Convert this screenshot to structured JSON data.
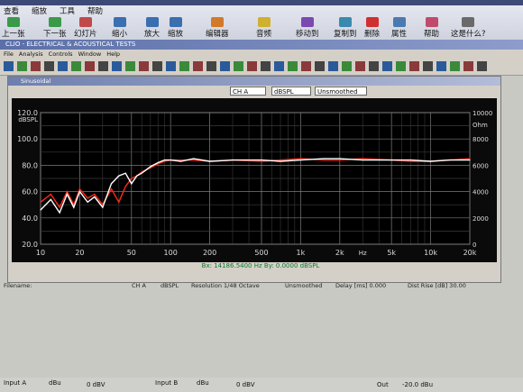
{
  "viewer": {
    "menu": [
      "查看",
      "缩放",
      "工具",
      "帮助"
    ],
    "tools": [
      {
        "label": "上一张",
        "icon": "prev-arrow-icon"
      },
      {
        "label": "下一张",
        "icon": "next-arrow-icon"
      },
      {
        "label": "幻灯片",
        "icon": "slideshow-icon"
      },
      {
        "label": "缩小",
        "icon": "zoom-out-icon"
      },
      {
        "label": "放大",
        "icon": "zoom-in-icon"
      },
      {
        "label": "缩放",
        "icon": "zoom-icon"
      },
      {
        "label": "编辑器",
        "icon": "editor-icon"
      },
      {
        "label": "音频",
        "icon": "audio-icon"
      },
      {
        "label": "移动到",
        "icon": "move-to-icon"
      },
      {
        "label": "复制到",
        "icon": "copy-to-icon"
      },
      {
        "label": "删除",
        "icon": "delete-icon"
      },
      {
        "label": "属性",
        "icon": "properties-icon"
      },
      {
        "label": "帮助",
        "icon": "help-icon"
      },
      {
        "label": "这是什么?",
        "icon": "whats-this-icon"
      }
    ]
  },
  "app": {
    "title": "CLIO - ELECTRICAL & ACOUSTICAL TESTS",
    "menu": [
      "File",
      "Analysis",
      "Controls",
      "Window",
      "Help"
    ]
  },
  "sinusoidal": {
    "title": "Sinusoidal",
    "channel": "CH A",
    "units": "dBSPL",
    "smoothing": "Unsmoothed"
  },
  "graph": {
    "left_unit": "dBSPL",
    "right_unit": "Ohm",
    "readout": "Bx: 14186.5400 Hz   By: 0.0000 dBSPL"
  },
  "status": {
    "filename": "Filename:",
    "channel": "CH A",
    "unit": "dBSPL",
    "resolution": "Resolution 1/48 Octave",
    "smoothing": "Unsmoothed",
    "delay": "Delay [ms] 0.000",
    "dist": "Dist Rise [dB] 30.00"
  },
  "bottom": {
    "input_a": "Input A",
    "input_a_unit": "dBu",
    "input_a_val": "0 dBV",
    "input_b": "Input B",
    "input_b_unit": "dBu",
    "input_b_val": "0 dBV",
    "out": "Out",
    "out_val": "-20.0 dBu"
  },
  "chart_data": {
    "type": "line",
    "xscale": "log",
    "xlim": [
      10,
      20000
    ],
    "x_ticks": [
      10,
      20,
      50,
      100,
      200,
      500,
      1000,
      2000,
      5000,
      10000,
      20000
    ],
    "x_tick_labels": [
      "10",
      "20",
      "50",
      "100",
      "200",
      "500",
      "1k",
      "2k",
      "5k",
      "10k",
      "20k"
    ],
    "x_unit": "Hz",
    "ylim": [
      20,
      120
    ],
    "y_ticks": [
      20,
      40,
      60,
      80,
      100,
      120
    ],
    "y_tick_labels": [
      "20.0",
      "40.0",
      "60.0",
      "80.0",
      "100.0",
      "120.0"
    ],
    "ylabel": "dBSPL",
    "y2lim": [
      0,
      10000
    ],
    "y2_ticks": [
      0,
      2000,
      4000,
      6000,
      8000,
      10000
    ],
    "y2label": "Ohm",
    "grid": true,
    "series": [
      {
        "color": "#ff2a1a",
        "x": [
          10,
          12,
          14,
          16,
          18,
          20,
          23,
          26,
          30,
          35,
          40,
          45,
          50,
          55,
          60,
          70,
          80,
          90,
          100,
          120,
          150,
          200,
          300,
          500,
          700,
          1000,
          1500,
          2000,
          3000,
          5000,
          7000,
          10000,
          14000,
          20000
        ],
        "y": [
          52,
          58,
          48,
          60,
          50,
          62,
          55,
          58,
          50,
          62,
          52,
          64,
          70,
          72,
          75,
          78,
          81,
          83,
          84,
          84,
          84,
          83,
          84,
          83,
          84,
          85,
          84,
          84,
          85,
          84,
          83,
          83,
          84,
          85
        ]
      },
      {
        "color": "#ffffff",
        "x": [
          10,
          12,
          14,
          16,
          18,
          20,
          23,
          26,
          30,
          35,
          40,
          45,
          50,
          55,
          60,
          70,
          80,
          90,
          100,
          120,
          150,
          200,
          300,
          500,
          700,
          1000,
          1500,
          2000,
          3000,
          5000,
          7000,
          10000,
          14000,
          20000
        ],
        "y": [
          46,
          54,
          44,
          58,
          48,
          60,
          52,
          56,
          48,
          66,
          72,
          74,
          66,
          72,
          74,
          79,
          82,
          84,
          84,
          83,
          85,
          83,
          84,
          84,
          83,
          84,
          85,
          85,
          84,
          84,
          84,
          83,
          84,
          84
        ]
      }
    ]
  }
}
